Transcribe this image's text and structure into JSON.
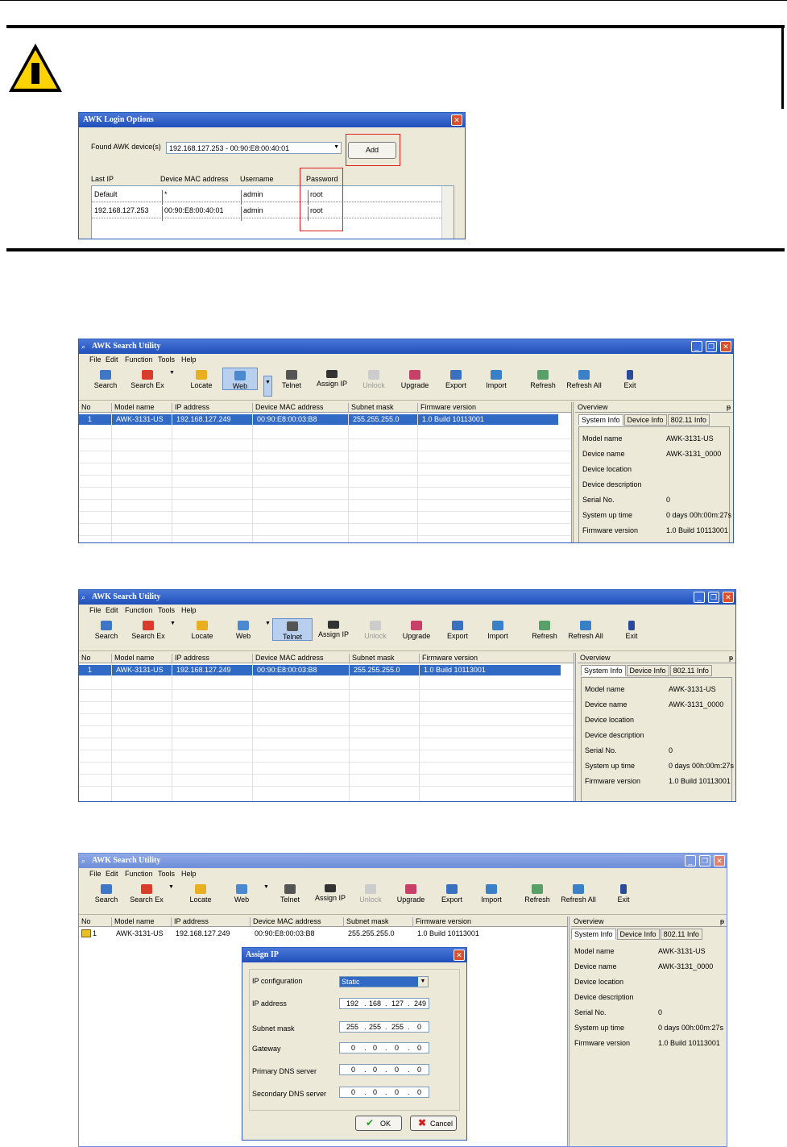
{
  "warning_dialog": {
    "title": "AWK Login Options",
    "close": "✕",
    "found_label": "Found AWK device(s)",
    "found_value": "192.168.127.253 - 00:90:E8:00:40:01",
    "add_button": "Add",
    "columns": [
      "Last IP",
      "Device MAC address",
      "Username",
      "Password"
    ],
    "rows": [
      [
        "Default",
        "*",
        "admin",
        "root"
      ],
      [
        "192.168.127.253",
        "00:90:E8:00:40:01",
        "admin",
        "root"
      ]
    ]
  },
  "app": {
    "title": "AWK Search Utility",
    "menu": [
      "File",
      "Edit",
      "Function",
      "Tools",
      "Help"
    ],
    "toolbar": [
      "Search",
      "Search Ex",
      "Locate",
      "Web",
      "Telnet",
      "Assign IP",
      "Unlock",
      "Upgrade",
      "Export",
      "Import",
      "Refresh",
      "Refresh All",
      "Exit"
    ],
    "columns": [
      "No",
      "Model name",
      "IP address",
      "Device MAC address",
      "Subnet mask",
      "Firmware version"
    ],
    "row": [
      "1",
      "AWK-3131-US",
      "192.168.127.249",
      "00:90:E8:00:03:B8",
      "255.255.255.0",
      "1.0 Build 10113001"
    ],
    "overview_title": "Overview",
    "pin": "ᵽ",
    "tabs": [
      "System Info",
      "Device Info",
      "802.11 Info"
    ],
    "info_rows": [
      {
        "label": "Model name",
        "value": "AWK-3131-US"
      },
      {
        "label": "Device name",
        "value": "AWK-3131_0000"
      },
      {
        "label": "Device location",
        "value": ""
      },
      {
        "label": "Device description",
        "value": ""
      },
      {
        "label": "Serial No.",
        "value": "0"
      },
      {
        "label": "System up time",
        "value": "0 days 00h:00m:27s"
      },
      {
        "label": "Firmware version",
        "value": "1.0 Build 10113001"
      }
    ],
    "window_buttons": [
      "_",
      "❐",
      "✕"
    ]
  },
  "assign_ip": {
    "title": "Assign IP",
    "close": "✕",
    "fields": [
      {
        "label": "IP configuration",
        "value": "Static"
      },
      {
        "label": "IP address",
        "octets": [
          "192",
          "168",
          "127",
          "249"
        ]
      },
      {
        "label": "Subnet mask",
        "octets": [
          "255",
          "255",
          "255",
          "0"
        ]
      },
      {
        "label": "Gateway",
        "octets": [
          "0",
          "0",
          "0",
          "0"
        ]
      },
      {
        "label": "Primary DNS server",
        "octets": [
          "0",
          "0",
          "0",
          "0"
        ]
      },
      {
        "label": "Secondary DNS server",
        "octets": [
          "0",
          "0",
          "0",
          "0"
        ]
      }
    ],
    "ok": "OK",
    "cancel": "Cancel"
  }
}
